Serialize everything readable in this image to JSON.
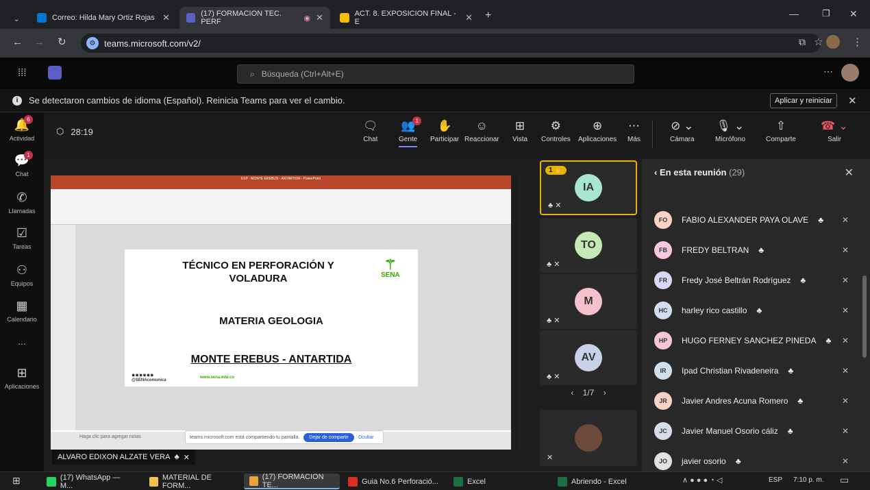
{
  "browser": {
    "tabs": [
      {
        "label": "Correo: Hilda Mary Ortiz Rojas",
        "color": "#0078d4"
      },
      {
        "label": "(17) FORMACION TEC. PERF",
        "color": "#5b5fc7"
      },
      {
        "label": "ACT. 8. EXPOSICION FINAL - E",
        "color": "#1a73e8"
      }
    ],
    "url": "teams.microsoft.com/v2/"
  },
  "teams": {
    "search_placeholder": "Búsqueda (Ctrl+Alt+E)",
    "banner_text": "Se detectaron cambios de idioma (Español). Reinicia Teams para ver el cambio.",
    "banner_button": "Aplicar y reiniciar",
    "rail": [
      {
        "label": "Actividad",
        "badge": "6"
      },
      {
        "label": "Chat",
        "badge": "1"
      },
      {
        "label": "Llamadas",
        "badge": ""
      },
      {
        "label": "Tareas",
        "badge": ""
      },
      {
        "label": "Equipos",
        "badge": ""
      },
      {
        "label": "Calendario",
        "badge": ""
      },
      {
        "label": "...",
        "badge": ""
      },
      {
        "label": "Aplicaciones",
        "badge": ""
      }
    ]
  },
  "meeting": {
    "timer": "28:19",
    "controls": {
      "chat": "Chat",
      "people": "Gente",
      "raise": "Participar",
      "react": "Reaccionar",
      "view": "Vista",
      "controls": "Controles",
      "apps": "Aplicaciones",
      "more": "Más",
      "camera": "Cámara",
      "mic": "Micrófono",
      "share": "Comparte",
      "leave": "Salir"
    },
    "people_badge": "1",
    "presenter": "ALVARO EDIXON ALZATE VERA",
    "share_notice": "teams.microsoft.com está compartiendo tu pantalla.",
    "stop_sharing": "Dejar de compartir",
    "hide": "Ocultar",
    "notes_placeholder": "Haga clic para agregar notas",
    "ppt_title": "ESP - MONTE EREBUS - ANTARTIDA - PowerPoint"
  },
  "slide": {
    "title_line1": "TÉCNICO EN PERFORACIÓN Y",
    "title_line2": "VOLADURA",
    "subtitle": "MATERIA GEOLOGIA",
    "topic": "MONTE EREBUS - ANTARTIDA",
    "logo_text": "SENA",
    "web": "www.sena.edu.co",
    "social": "@SENAcomunica"
  },
  "tiles": [
    {
      "initials": "IA",
      "color": "#a8e6cf",
      "hand": "1"
    },
    {
      "initials": "TO",
      "color": "#c5e8b7"
    },
    {
      "initials": "M",
      "color": "#f6c1cf"
    },
    {
      "initials": "AV",
      "color": "#c9d1e8"
    }
  ],
  "pager": "1/7",
  "people_panel": {
    "title": "En esta reunión",
    "count": "(29)",
    "participants": [
      {
        "initials": "FO",
        "name": "FABIO ALEXANDER PAYA OLAVE",
        "color": "#fbd3c4"
      },
      {
        "initials": "FB",
        "name": "FREDY BELTRAN",
        "color": "#f6c9e1"
      },
      {
        "initials": "FR",
        "name": "Fredy José Beltrán Rodríguez",
        "color": "#d6d8f4"
      },
      {
        "initials": "HC",
        "name": "harley rico castillo",
        "color": "#d3dcef"
      },
      {
        "initials": "HP",
        "name": "HUGO FERNEY SANCHEZ PINEDA",
        "color": "#f5c6d7"
      },
      {
        "initials": "IR",
        "name": "Ipad Christian Rivadeneira",
        "color": "#cfe0ea"
      },
      {
        "initials": "JR",
        "name": "Javier Andres Acuna Romero",
        "color": "#f8d2c4"
      },
      {
        "initials": "JC",
        "name": "Javier Manuel Osorio cáliz",
        "color": "#d6dde6"
      },
      {
        "initials": "JO",
        "name": "javier osorio",
        "color": "#e2e2e2"
      }
    ]
  },
  "taskbar": {
    "items": [
      {
        "label": "(17) WhatsApp — M...",
        "color": "#25d366"
      },
      {
        "label": "MATERIAL DE FORM...",
        "color": "#f2c14e"
      },
      {
        "label": "(17) FORMACION TE...",
        "color": "#e8a33d"
      },
      {
        "label": "Guia No.6 Perforació...",
        "color": "#d93025"
      },
      {
        "label": "Excel",
        "color": "#1d6f42"
      },
      {
        "label": "Abriendo - Excel",
        "color": "#1d6f42"
      }
    ],
    "lang": "ESP",
    "time": "7:10 p. m."
  }
}
